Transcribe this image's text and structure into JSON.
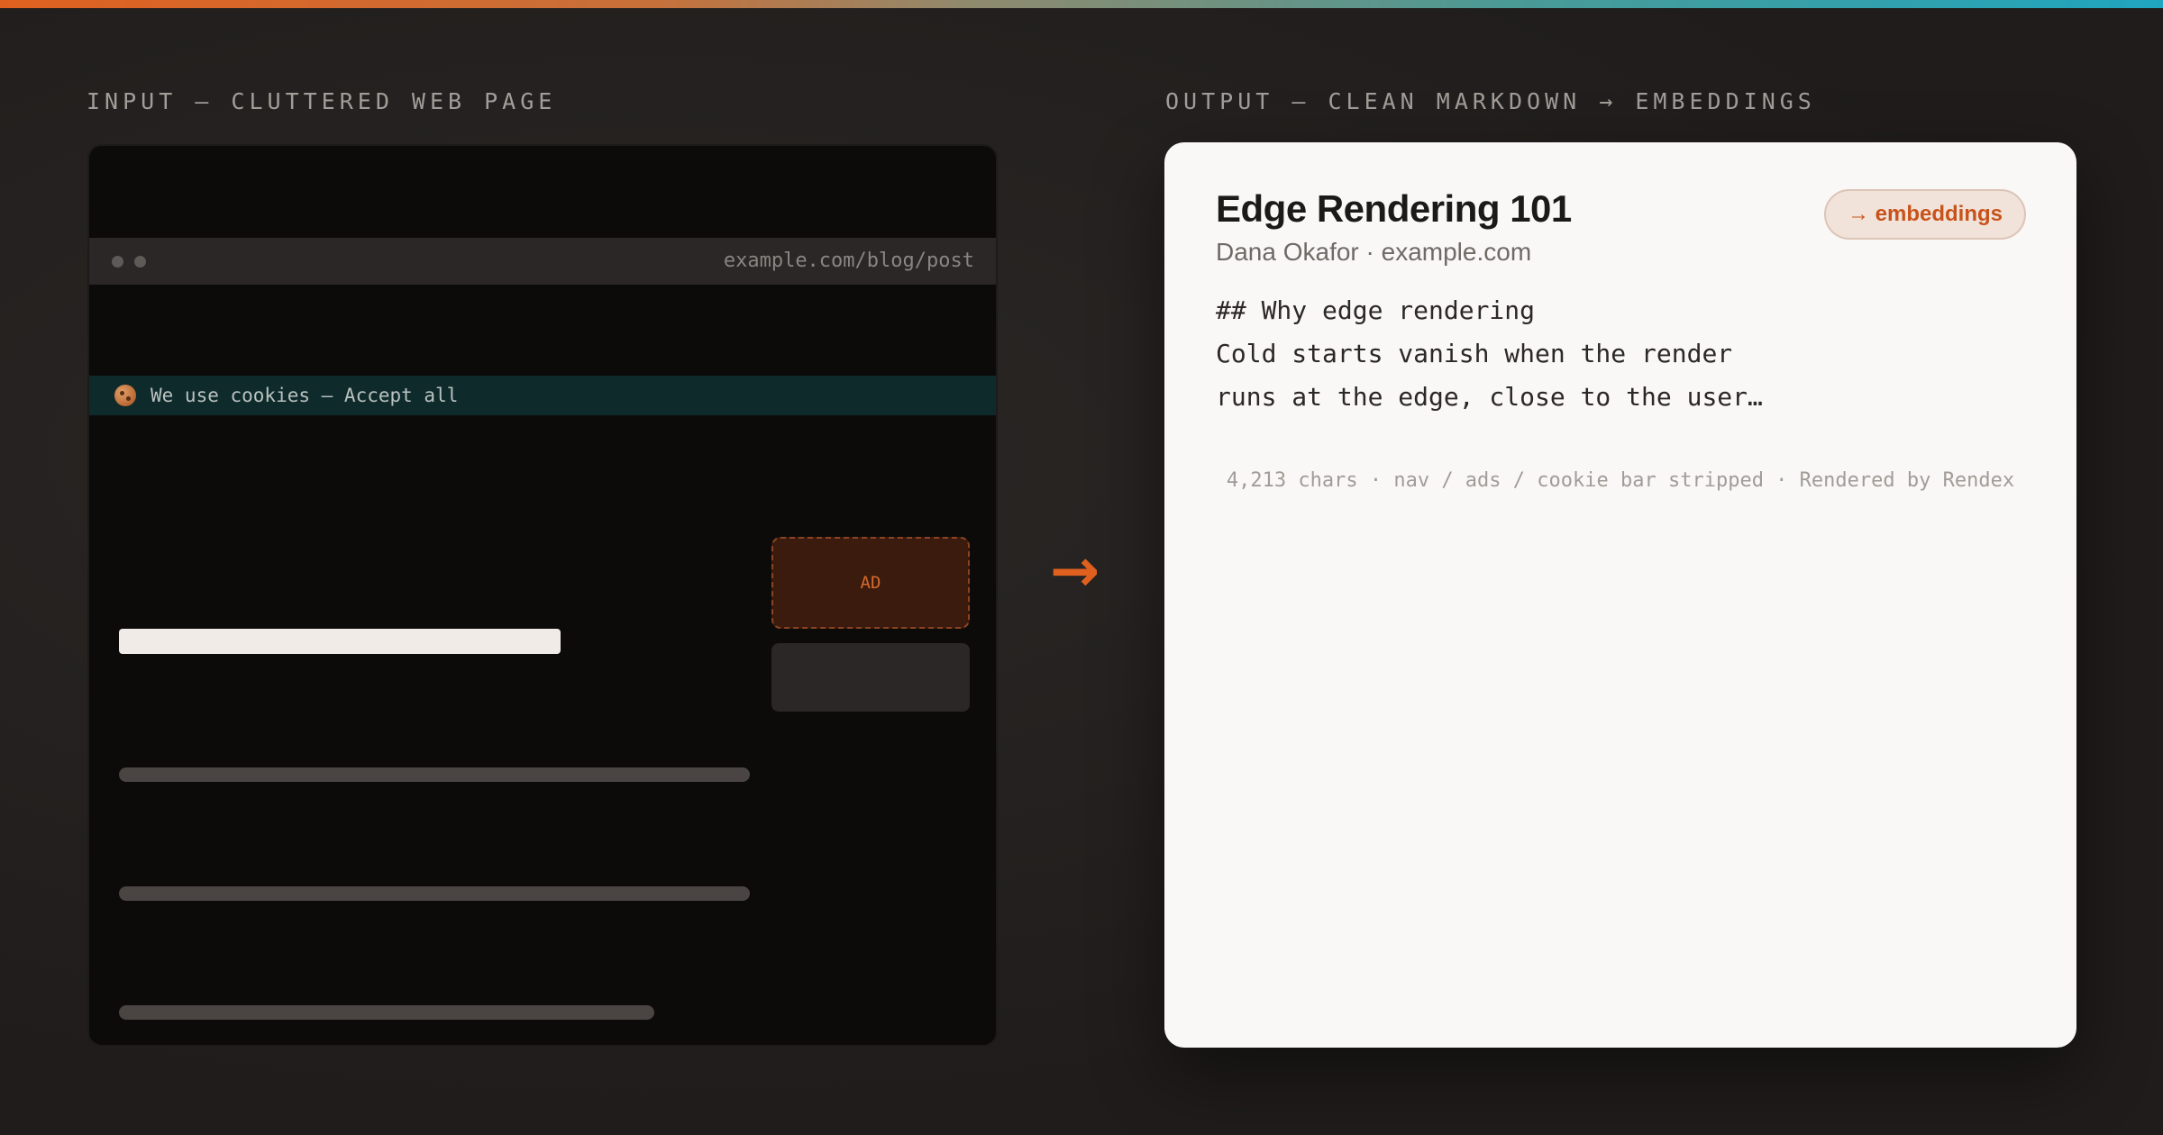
{
  "labels": {
    "input": "INPUT — CLUTTERED WEB PAGE",
    "output": "OUTPUT — CLEAN MARKDOWN → EMBEDDINGS"
  },
  "input_page": {
    "url": "example.com/blog/post",
    "cookie_banner": "We use cookies — Accept all",
    "ad_label": "AD"
  },
  "arrow": "→",
  "output_card": {
    "title": "Edge Rendering 101",
    "meta": "Dana Okafor · example.com",
    "chip": "→ embeddings",
    "markdown_lines": [
      "## Why edge rendering",
      "Cold starts vanish when the render",
      "runs at the edge, close to the user…"
    ],
    "stats": "4,213 chars · nav / ads / cookie bar stripped · Rendered by Rendex"
  },
  "colors": {
    "accent": "#e0611f",
    "background": "#221f1e",
    "card": "#f9f8f6"
  }
}
